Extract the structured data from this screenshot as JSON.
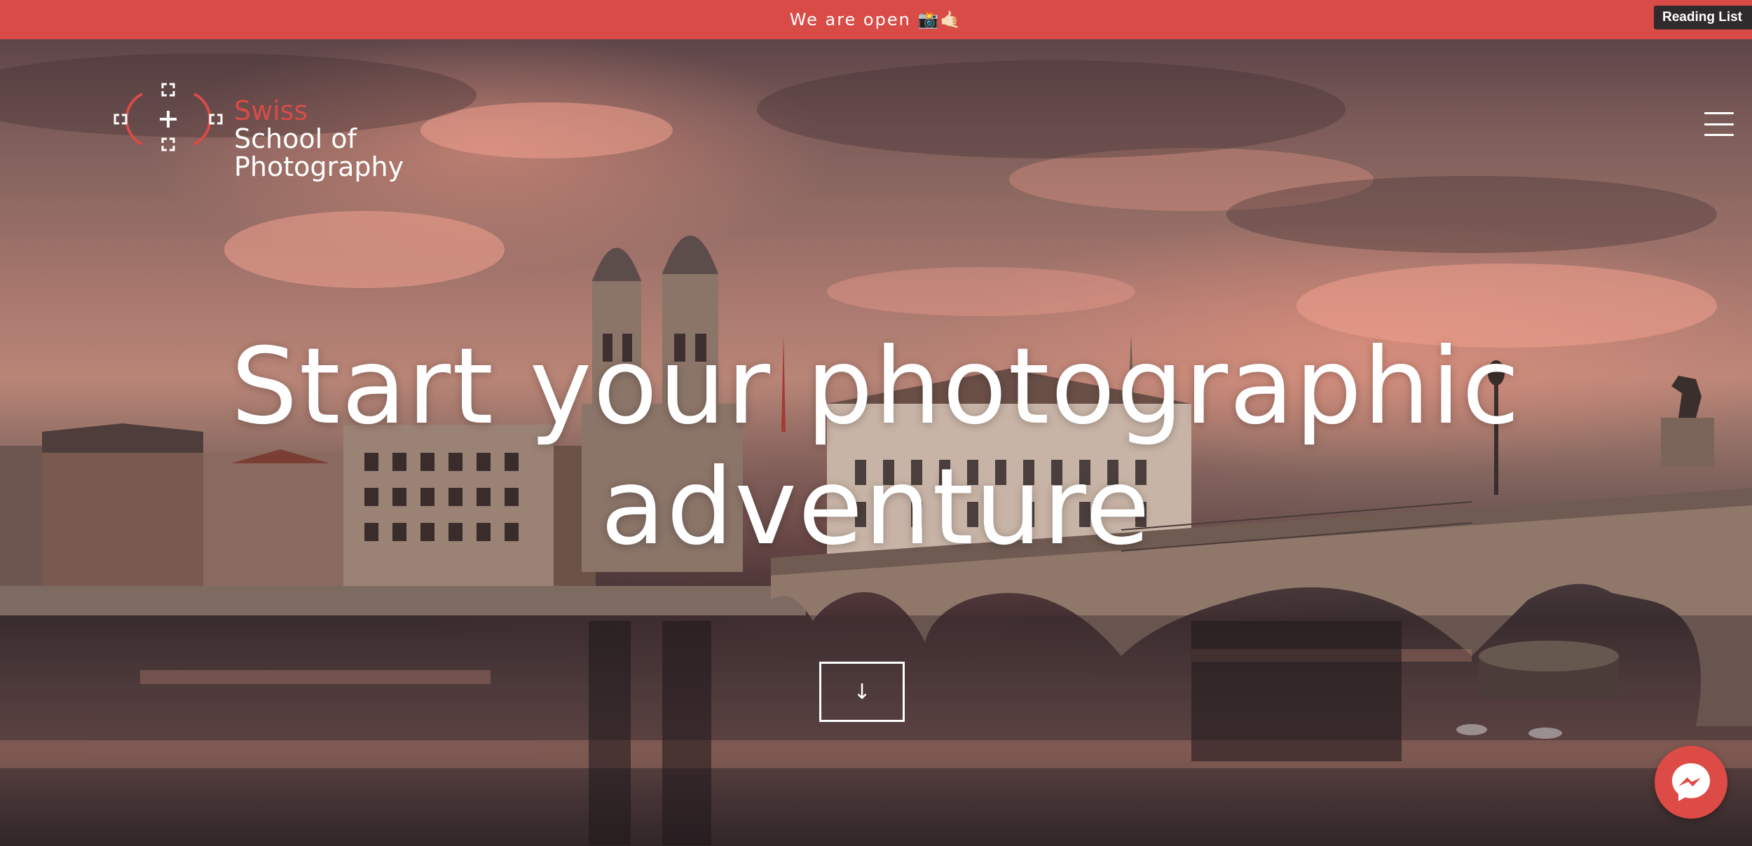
{
  "announcement": {
    "text": "We are open 📸🤙🏻"
  },
  "browser": {
    "reading_list_label": "Reading List"
  },
  "brand": {
    "line1": "Swiss",
    "line2": "School of",
    "line3": "Photography"
  },
  "hero": {
    "headline_line1": "Start your photographic",
    "headline_line2": "adventure",
    "scroll_button_glyph": "↓"
  },
  "icons": {
    "logo": "camera-viewfinder-icon",
    "menu": "hamburger-menu-icon",
    "scroll": "arrow-down-icon",
    "chat": "messenger-icon"
  },
  "colors": {
    "accent": "#d94b47",
    "topbar": "#d94b47",
    "text_light": "#ffffff"
  }
}
